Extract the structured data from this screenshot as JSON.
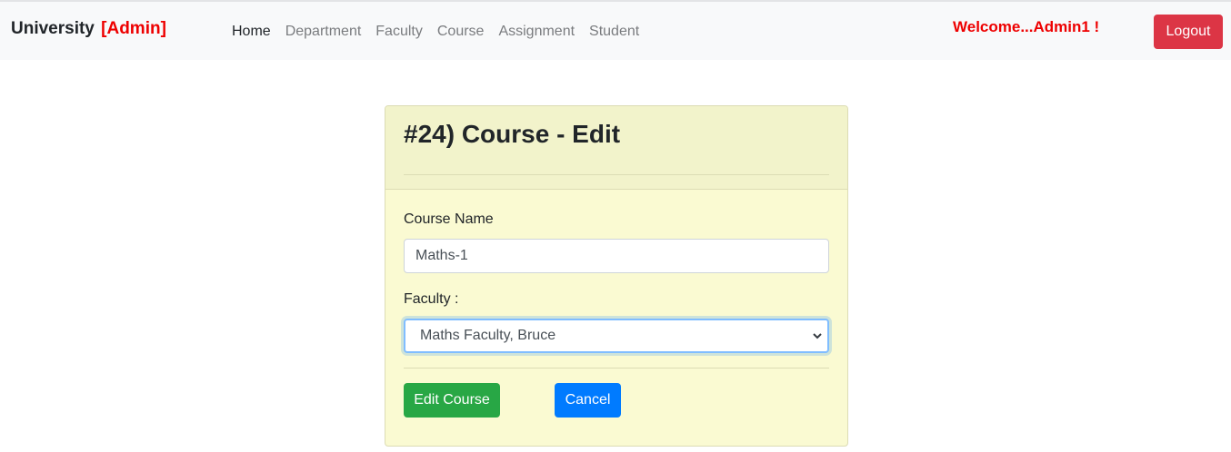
{
  "navbar": {
    "brand": "University",
    "role": "[Admin]",
    "links": [
      "Home",
      "Department",
      "Faculty",
      "Course",
      "Assignment",
      "Student"
    ],
    "welcome": "Welcome...Admin1 !",
    "logout_label": "Logout"
  },
  "card": {
    "title": "#24) Course - Edit",
    "course_name_label": "Course Name",
    "course_name_value": "Maths-1",
    "faculty_label": "Faculty :",
    "faculty_selected": "Maths Faculty, Bruce",
    "edit_button": "Edit Course",
    "cancel_button": "Cancel"
  },
  "colors": {
    "accent_red": "#ee0000",
    "logout": "#dc3545",
    "edit": "#28a745",
    "cancel": "#007bff",
    "card_bg": "#fafad2"
  }
}
